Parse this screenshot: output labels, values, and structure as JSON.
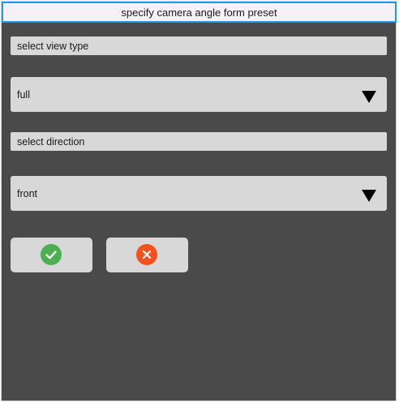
{
  "dialog": {
    "title": "specify camera angle form preset"
  },
  "view_type": {
    "label": "select view type",
    "selected": "full"
  },
  "direction": {
    "label": "select direction",
    "selected": "front"
  },
  "buttons": {
    "confirm_icon": "check-icon",
    "cancel_icon": "close-icon",
    "confirm_color": "#4caf50",
    "cancel_color": "#f4511e"
  },
  "colors": {
    "background": "#4a4a4a",
    "title_border": "#2196f3",
    "field": "#d8d8d8"
  }
}
